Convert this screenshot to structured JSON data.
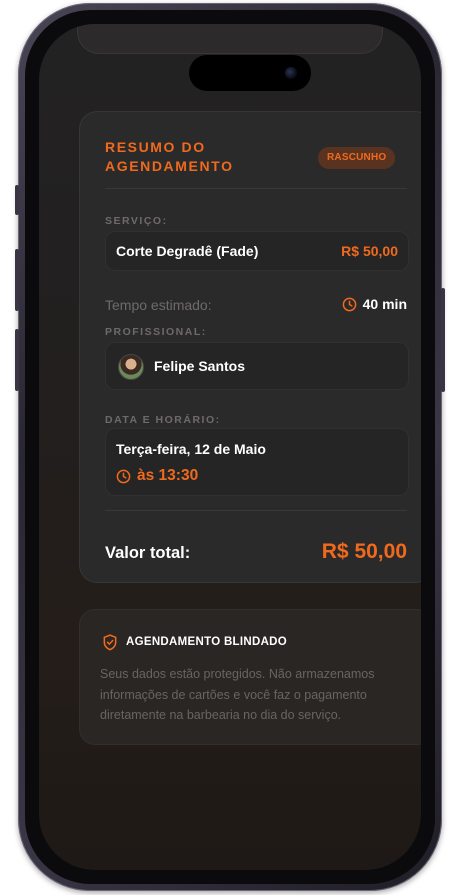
{
  "summary": {
    "title": "RESUMO DO AGENDAMENTO",
    "status_badge": "RASCUNHO",
    "service_label": "SERVIÇO:",
    "service_name": "Corte Degradê (Fade)",
    "service_price": "R$ 50,00",
    "estimated_time_label": "Tempo estimado:",
    "estimated_time_value": "40 min",
    "professional_label": "PROFISSIONAL:",
    "professional_name": "Felipe Santos",
    "datetime_label": "DATA E HORÁRIO:",
    "date": "Terça-feira, 12 de Maio",
    "time": "às 13:30",
    "total_label": "Valor total:",
    "total_value": "R$ 50,00"
  },
  "security": {
    "title": "AGENDAMENTO BLINDADO",
    "description": "Seus dados estão protegidos. Não armazenamos informações de cartões e você faz o pagamento diretamente na barbearia no dia do serviço."
  },
  "icons": {
    "clock": "clock-icon",
    "shield": "shield-icon",
    "avatar": "avatar"
  },
  "colors": {
    "accent": "#f06a1d",
    "background": "#232223",
    "card": "#2b2a2b",
    "muted_text": "#6e6a68"
  }
}
